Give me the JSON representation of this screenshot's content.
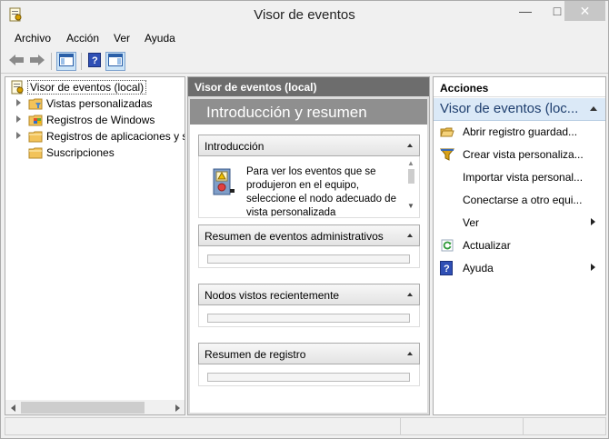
{
  "window": {
    "title": "Visor de eventos",
    "controls": {
      "minimize": "—",
      "maximize": "□",
      "close": "✕"
    }
  },
  "menu": [
    "Archivo",
    "Acción",
    "Ver",
    "Ayuda"
  ],
  "toolbar": {
    "buttons": [
      "back-icon",
      "forward-icon",
      "show-hide-console-tree-icon",
      "help-icon",
      "show-hide-action-pane-icon"
    ]
  },
  "tree": {
    "root": "Visor de eventos (local)",
    "items": [
      {
        "label": "Vistas personalizadas",
        "icon": "folder-filter-icon",
        "expandable": true
      },
      {
        "label": "Registros de Windows",
        "icon": "windows-logs-icon",
        "expandable": true
      },
      {
        "label": "Registros de aplicaciones y s",
        "icon": "folder-icon",
        "expandable": true
      },
      {
        "label": "Suscripciones",
        "icon": "folder-icon",
        "expandable": false
      }
    ]
  },
  "middle": {
    "header": "Visor de eventos (local)",
    "banner": "Introducción y resumen",
    "sections": [
      {
        "title": "Introducción",
        "text": "Para ver los eventos que se produjeron en el equipo, seleccione el nodo adecuado de vista personalizada"
      },
      {
        "title": "Resumen de eventos administrativos"
      },
      {
        "title": "Nodos vistos recientemente"
      },
      {
        "title": "Resumen de registro"
      }
    ]
  },
  "actions": {
    "header": "Acciones",
    "group": "Visor de eventos (loc...",
    "items": [
      {
        "label": "Abrir registro guardad...",
        "icon": "open-folder-icon",
        "submenu": false
      },
      {
        "label": "Crear vista personaliza...",
        "icon": "filter-icon",
        "submenu": false
      },
      {
        "label": "Importar vista personal...",
        "icon": "",
        "submenu": false
      },
      {
        "label": "Conectarse a otro equi...",
        "icon": "",
        "submenu": false
      },
      {
        "label": "Ver",
        "icon": "",
        "submenu": true
      },
      {
        "label": "Actualizar",
        "icon": "refresh-icon",
        "submenu": false
      },
      {
        "label": "Ayuda",
        "icon": "help-icon",
        "submenu": true
      }
    ]
  },
  "colors": {
    "pane_header": "#6d6d6d",
    "banner": "#8f8f8f",
    "action_group_bg": "#dbe9f7",
    "selection_border": "#7da2ce"
  }
}
